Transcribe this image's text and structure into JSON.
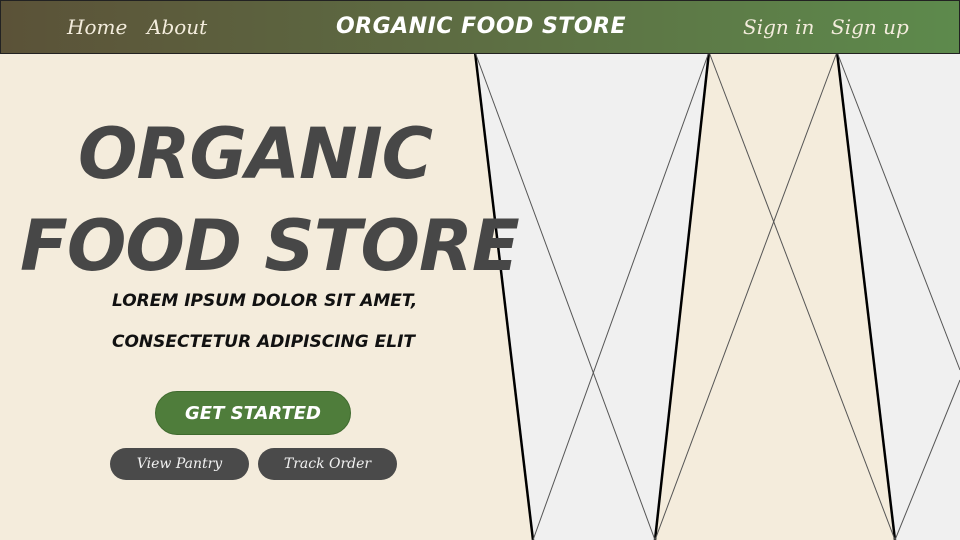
{
  "nav": {
    "home_label": "Home",
    "about_label": "About",
    "brand": "ORGANIC FOOD STORE",
    "signin_label": "Sign in",
    "signup_label": "Sign up"
  },
  "hero": {
    "title_line1": "ORGANIC",
    "title_line2": "FOOD STORE",
    "subtitle_line1": "LOREM IPSUM DOLOR SIT AMET,",
    "subtitle_line2": "CONSECTETUR ADIPISCING ELIT",
    "cta_label": "GET STARTED",
    "view_pantry_label": "View Pantry",
    "track_order_label": "Track Order"
  },
  "colors": {
    "accent_green": "#4f7d3b",
    "panel_cream": "#f4ecdc",
    "panel_grey": "#f0f0f0",
    "nav_gradient_start": "#5b5238",
    "nav_gradient_end": "#5d8a4c",
    "secondary_button": "#4a4a4a",
    "title_text": "#474747"
  }
}
